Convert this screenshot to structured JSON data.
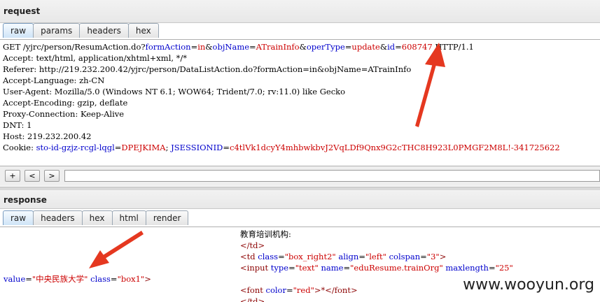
{
  "request": {
    "title": "request",
    "tabs": [
      "raw",
      "params",
      "headers",
      "hex"
    ],
    "lines": {
      "get": {
        "prefix": "GET /yjrc/person/ResumAction.do?",
        "k1": "formAction",
        "eq1": "=",
        "v1": "in",
        "amp1": "&",
        "k2": "objName",
        "eq2": "=",
        "v2": "ATrainInfo",
        "amp2": "&",
        "k3": "operType",
        "eq3": "=",
        "v3": "update",
        "amp3": "&",
        "k4": "id",
        "eq4": "=",
        "v4": "608747",
        "suffix": " HTTP/1.1"
      },
      "accept": "Accept: text/html, application/xhtml+xml, */*",
      "referer": "Referer: http://219.232.200.42/yjrc/person/DataListAction.do?formAction=in&objName=ATrainInfo",
      "accept_language": "Accept-Language: zh-CN",
      "user_agent": "User-Agent: Mozilla/5.0 (Windows NT 6.1; WOW64; Trident/7.0; rv:11.0) like Gecko",
      "accept_encoding": "Accept-Encoding: gzip, deflate",
      "proxy_connection": "Proxy-Connection: Keep-Alive",
      "dnt": "DNT: 1",
      "host": "Host: 219.232.200.42",
      "cookie": {
        "prefix": "Cookie: ",
        "k1": "sto-id-gzjz-rcgl-lqgl",
        "eq1": "=",
        "v1": "DPEJKIMA",
        "sep": "; ",
        "k2": "JSESSIONID",
        "eq2": "=",
        "v2": "c4tlVk1dcyY4mhbwkbvJ2VqLDf9Qnx9G2cTHC8H923L0PMGF2M8L!-341725622"
      }
    },
    "nav": {
      "plus": "+",
      "prev": "<",
      "next": ">",
      "search_value": ""
    }
  },
  "response": {
    "title": "response",
    "tabs": [
      "raw",
      "headers",
      "hex",
      "html",
      "render"
    ],
    "code": {
      "label": "教育培训机构:",
      "td_close": "</td>",
      "td_open": {
        "open": "<td ",
        "a1": "class",
        "eq": "=",
        "v1": "\"box_right2\"",
        "a2": " align",
        "v2": "\"left\"",
        "a3": " colspan",
        "v3": "\"3\"",
        "close": ">"
      },
      "input": {
        "open": "<input ",
        "a1": "type",
        "eq": "=",
        "v1": "\"text\"",
        "a2": " name",
        "v2": "\"eduResume.trainOrg\"",
        "a3": " maxlength",
        "v3": "\"25\""
      },
      "value_line": {
        "a1": "value",
        "eq": "=",
        "v1": "\"中央民族大学\"",
        "a2": " class",
        "v2": "\"box1\"",
        "close": ">"
      },
      "font": {
        "open": "<font ",
        "a1": "color",
        "eq": "=",
        "v1": "\"red\"",
        "mid": ">*</font>"
      },
      "td_close2": "</td>"
    }
  },
  "watermark": "www.wooyun.org",
  "colors": {
    "param_key": "#0000cc",
    "param_value": "#cc0000",
    "arrow": "#e53820"
  }
}
